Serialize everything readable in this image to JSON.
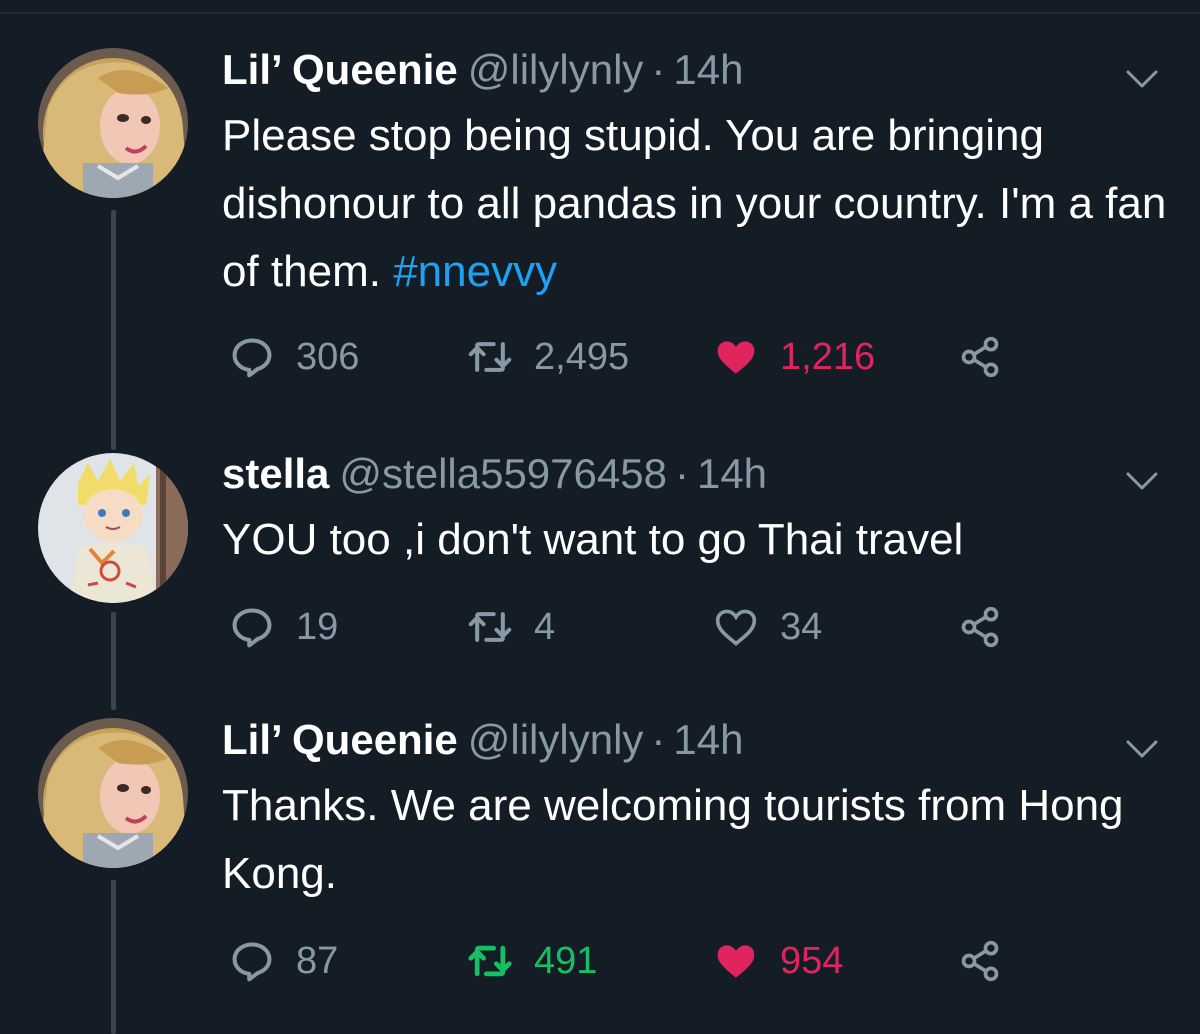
{
  "tweets": [
    {
      "name": "Lil’ Queenie",
      "handle": "@lilylynly",
      "separator": "·",
      "time": "14h",
      "text_parts": [
        "Please stop being stupid. You are bringing dishonour to all pandas in your country. I'm a fan of them. "
      ],
      "hashtag": "#nnevvy",
      "replies": "306",
      "retweets": "2,495",
      "likes": "1,216",
      "liked": true,
      "retweeted": false
    },
    {
      "name": "stella",
      "handle": "@stella55976458",
      "separator": "·",
      "time": "14h",
      "text_parts": [
        "YOU too ,i don't want to go Thai travel"
      ],
      "hashtag": "",
      "replies": "19",
      "retweets": "4",
      "likes": "34",
      "liked": false,
      "retweeted": false
    },
    {
      "name": "Lil’ Queenie",
      "handle": "@lilylynly",
      "separator": "·",
      "time": "14h",
      "text_parts": [
        "Thanks. We are welcoming tourists from Hong Kong."
      ],
      "hashtag": "",
      "replies": "87",
      "retweets": "491",
      "likes": "954",
      "liked": true,
      "retweeted": true
    }
  ],
  "colors": {
    "background": "#141d26",
    "text": "#ffffff",
    "muted": "#8899a6",
    "link": "#1da1f2",
    "like": "#e0245e",
    "retweet": "#17bf63"
  },
  "icons": [
    "reply-icon",
    "retweet-icon",
    "heart-icon",
    "share-icon",
    "chevron-down-icon"
  ]
}
